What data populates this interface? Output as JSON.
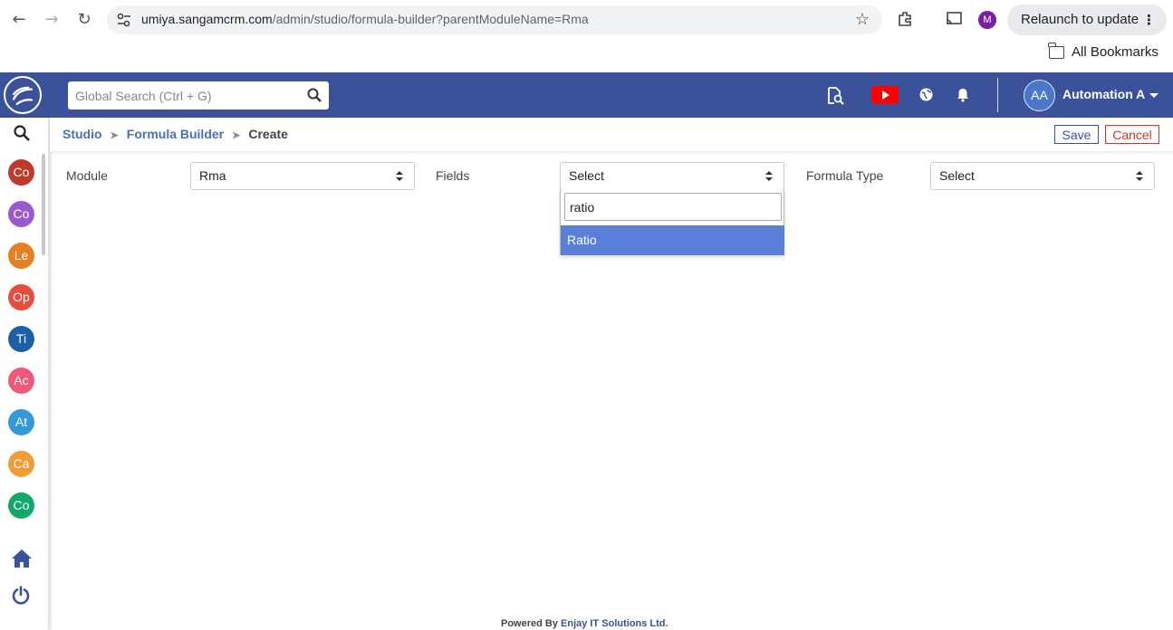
{
  "browser": {
    "url_host": "umiya.sangamcrm.com",
    "url_path": "/admin/studio/formula-builder?parentModuleName=Rma",
    "profile_initial": "M",
    "relaunch_label": "Relaunch to update",
    "bookmarks_label": "All Bookmarks"
  },
  "header": {
    "search_placeholder": "Global Search (Ctrl + G)",
    "avatar_initials": "AA",
    "user_name": "Automation A",
    "colors": {
      "bar": "#3b5199",
      "youtube": "#ff0000"
    }
  },
  "sidebar": {
    "modules": [
      {
        "label": "Co",
        "color": "#c0392b"
      },
      {
        "label": "Co",
        "color": "#9b59d0"
      },
      {
        "label": "Le",
        "color": "#e67e22"
      },
      {
        "label": "Op",
        "color": "#e74c3c"
      },
      {
        "label": "Ti",
        "color": "#1f5fa8"
      },
      {
        "label": "Ac",
        "color": "#f0587a"
      },
      {
        "label": "At",
        "color": "#3498db"
      },
      {
        "label": "Ca",
        "color": "#f39c34"
      },
      {
        "label": "Co",
        "color": "#12a86b"
      }
    ]
  },
  "breadcrumb": {
    "items": [
      "Studio",
      "Formula Builder"
    ],
    "current": "Create"
  },
  "actions": {
    "save": "Save",
    "cancel": "Cancel"
  },
  "form": {
    "module_label": "Module",
    "module_value": "Rma",
    "fields_label": "Fields",
    "fields_value": "Select",
    "fields_search": "ratio",
    "fields_option": "Ratio",
    "formula_type_label": "Formula Type",
    "formula_type_value": "Select"
  },
  "footer": {
    "prefix": "Powered By",
    "company": "Enjay IT Solutions Ltd."
  }
}
